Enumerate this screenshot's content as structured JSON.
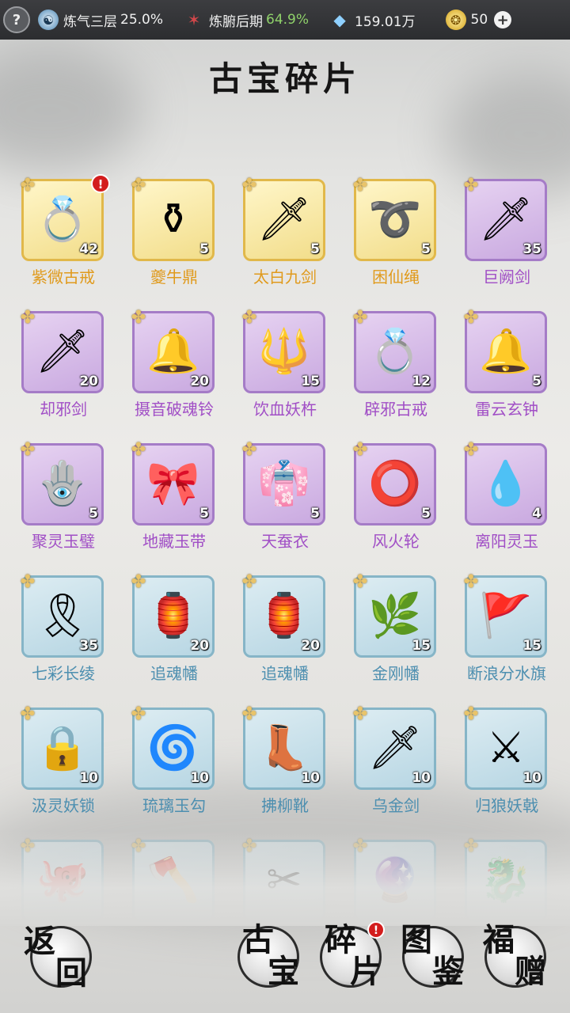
{
  "topbar": {
    "help_icon": "question-icon",
    "cultivation_label": "炼气三层",
    "cultivation_pct": "25.0%",
    "body_label": "炼腑后期",
    "body_pct": "64.9%",
    "spirit_stones": "159.01万",
    "gold": "50",
    "add_icon": "plus-icon"
  },
  "title": "古宝碎片",
  "items": [
    {
      "name": "紫微古戒",
      "count": "42",
      "rarity": "gold",
      "icon": "ring-icon",
      "alert": true
    },
    {
      "name": "夔牛鼎",
      "count": "5",
      "rarity": "gold",
      "icon": "cauldron-icon",
      "alert": false
    },
    {
      "name": "太白九剑",
      "count": "5",
      "rarity": "gold",
      "icon": "sword-icon",
      "alert": false
    },
    {
      "name": "困仙绳",
      "count": "5",
      "rarity": "gold",
      "icon": "rope-icon",
      "alert": false
    },
    {
      "name": "巨阙剑",
      "count": "35",
      "rarity": "purple",
      "icon": "sword-icon",
      "alert": false
    },
    {
      "name": "却邪剑",
      "count": "20",
      "rarity": "purple",
      "icon": "sword-icon",
      "alert": false
    },
    {
      "name": "摄音破魂铃",
      "count": "20",
      "rarity": "purple",
      "icon": "bell-icon",
      "alert": false
    },
    {
      "name": "饮血妖杵",
      "count": "15",
      "rarity": "purple",
      "icon": "vajra-icon",
      "alert": false
    },
    {
      "name": "辟邪古戒",
      "count": "12",
      "rarity": "purple",
      "icon": "ring-icon",
      "alert": false
    },
    {
      "name": "雷云玄钟",
      "count": "5",
      "rarity": "purple",
      "icon": "bell-icon",
      "alert": false
    },
    {
      "name": "聚灵玉璧",
      "count": "5",
      "rarity": "purple",
      "icon": "jade-disc-icon",
      "alert": false
    },
    {
      "name": "地藏玉带",
      "count": "5",
      "rarity": "purple",
      "icon": "belt-icon",
      "alert": false
    },
    {
      "name": "天蚕衣",
      "count": "5",
      "rarity": "purple",
      "icon": "robe-icon",
      "alert": false
    },
    {
      "name": "风火轮",
      "count": "5",
      "rarity": "purple",
      "icon": "wheel-icon",
      "alert": false
    },
    {
      "name": "离阳灵玉",
      "count": "4",
      "rarity": "purple",
      "icon": "jade-icon",
      "alert": false
    },
    {
      "name": "七彩长绫",
      "count": "35",
      "rarity": "blue",
      "icon": "ribbon-icon",
      "alert": false
    },
    {
      "name": "追魂幡",
      "count": "20",
      "rarity": "blue",
      "icon": "banner-icon",
      "alert": false
    },
    {
      "name": "追魂幡",
      "count": "20",
      "rarity": "blue",
      "icon": "banner-icon",
      "alert": false
    },
    {
      "name": "金刚幡",
      "count": "15",
      "rarity": "blue",
      "icon": "leaf-banner-icon",
      "alert": false
    },
    {
      "name": "断浪分水旗",
      "count": "15",
      "rarity": "blue",
      "icon": "flag-icon",
      "alert": false
    },
    {
      "name": "汲灵妖锁",
      "count": "10",
      "rarity": "blue",
      "icon": "lock-icon",
      "alert": false
    },
    {
      "name": "琉璃玉勾",
      "count": "10",
      "rarity": "blue",
      "icon": "hook-icon",
      "alert": false
    },
    {
      "name": "拂柳靴",
      "count": "10",
      "rarity": "blue",
      "icon": "boot-icon",
      "alert": false
    },
    {
      "name": "乌金剑",
      "count": "10",
      "rarity": "blue",
      "icon": "sword-icon",
      "alert": false
    },
    {
      "name": "归狼妖戟",
      "count": "10",
      "rarity": "blue",
      "icon": "halberd-icon",
      "alert": false
    },
    {
      "name": "",
      "count": "",
      "rarity": "blue",
      "icon": "beast-icon",
      "alert": false,
      "partial": true
    },
    {
      "name": "",
      "count": "",
      "rarity": "blue",
      "icon": "spear-icon",
      "alert": false,
      "partial": true
    },
    {
      "name": "",
      "count": "",
      "rarity": "blue",
      "icon": "needle-icon",
      "alert": false,
      "partial": true
    },
    {
      "name": "",
      "count": "",
      "rarity": "blue",
      "icon": "orb-icon",
      "alert": false,
      "partial": true
    },
    {
      "name": "",
      "count": "",
      "rarity": "blue",
      "icon": "dragon-staff-icon",
      "alert": false,
      "partial": true
    }
  ],
  "bottom": {
    "back": [
      "返",
      "回"
    ],
    "tab_treasure": [
      "古",
      "宝"
    ],
    "tab_fragments": [
      "碎",
      "片"
    ],
    "tab_atlas": [
      "图",
      "鉴"
    ],
    "tab_gift": [
      "福",
      "赠"
    ],
    "fragments_alert": true
  },
  "colors": {
    "gold": "#e09a1c",
    "purple": "#a14fc6",
    "blue": "#4d8fb0",
    "alert": "#d31d1d"
  }
}
